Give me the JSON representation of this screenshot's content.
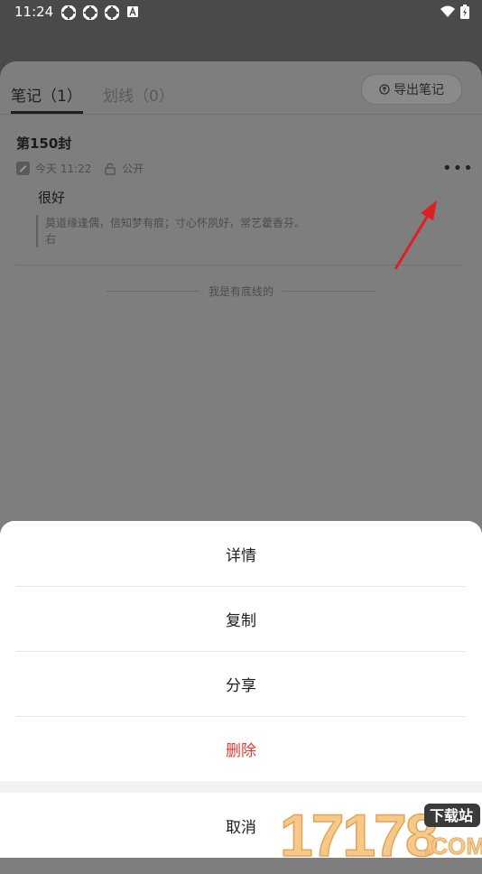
{
  "status_bar": {
    "time": "11:24"
  },
  "tabs": [
    {
      "label": "笔记（1）"
    },
    {
      "label": "划线（0）"
    }
  ],
  "export_button": "导出笔记",
  "note": {
    "title": "第150封",
    "time": "今天 11:22",
    "visibility": "公开",
    "text": "很好",
    "quote": "莫道缘逢偶，信知梦有痕；寸心怀夙好，常艺藿香芬。",
    "quote_author": "右"
  },
  "bottom_text": "我是有底线的",
  "menu": {
    "items": [
      "详情",
      "复制",
      "分享",
      "删除"
    ],
    "cancel": "取消"
  },
  "watermark": {
    "digits": "17178",
    "badge": "下载站",
    "domain": ".COM"
  },
  "colors": {
    "danger": "#e53935",
    "arrow": "#e02020"
  }
}
